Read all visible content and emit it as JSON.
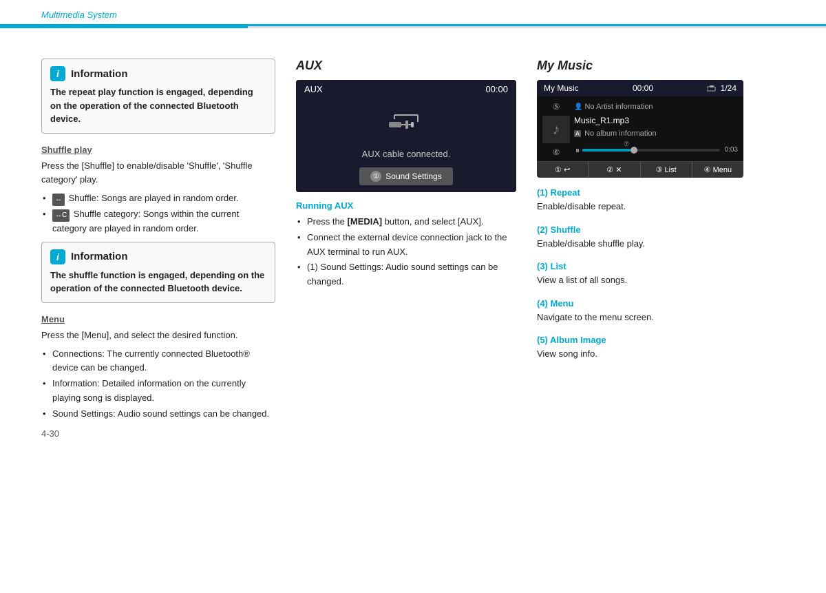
{
  "header": {
    "title": "Multimedia System"
  },
  "left": {
    "info1": {
      "title": "Information",
      "text": "The repeat play function is engaged, depending on the operation of the connected Bluetooth device."
    },
    "shuffle_section": {
      "title": "Shuffle play",
      "body": "Press the [Shuffle] to enable/disable 'Shuffle', 'Shuffle category' play.",
      "bullets": [
        "Shuffle: Songs are played in random order.",
        "Shuffle category: Songs within the current category are played in random order."
      ]
    },
    "info2": {
      "title": "Information",
      "text": "The shuffle function is engaged, depending on the operation of the connected Bluetooth device."
    },
    "menu_section": {
      "title": "Menu",
      "body": "Press the [Menu], and select the desired function.",
      "bullets": [
        "Connections: The currently connected Bluetooth® device can be changed.",
        "Information: Detailed information on the currently playing song is displayed.",
        "Sound Settings: Audio sound settings can be changed."
      ]
    },
    "page_num": "4-30"
  },
  "mid": {
    "title": "AUX",
    "screen": {
      "label": "AUX",
      "time": "00:00",
      "cable_text": "AUX cable connected.",
      "sound_btn": "Sound Settings"
    },
    "running_title": "Running AUX",
    "bullets": [
      "Press the [MEDIA] button, and select [AUX].",
      "Connect the external device connection jack to the AUX terminal to run AUX.",
      "(1) Sound Settings: Audio sound settings can be changed."
    ]
  },
  "right": {
    "title": "My Music",
    "screen": {
      "label": "My Music",
      "time": "00:00",
      "track_num": "1/24",
      "artist": "No Artist information",
      "song": "Music_R1.mp3",
      "album": "No album information",
      "duration": "0:03",
      "btn1": "② ✕",
      "btn2": "③ List",
      "btn3": "④ Menu"
    },
    "items": [
      {
        "label": "(1) Repeat",
        "desc": "Enable/disable repeat."
      },
      {
        "label": "(2) Shuffle",
        "desc": "Enable/disable shuffle play."
      },
      {
        "label": "(3) List",
        "desc": "View a list of all songs."
      },
      {
        "label": "(4) Menu",
        "desc": "Navigate to the menu screen."
      },
      {
        "label": "(5) Album Image",
        "desc": "View song info."
      }
    ]
  }
}
